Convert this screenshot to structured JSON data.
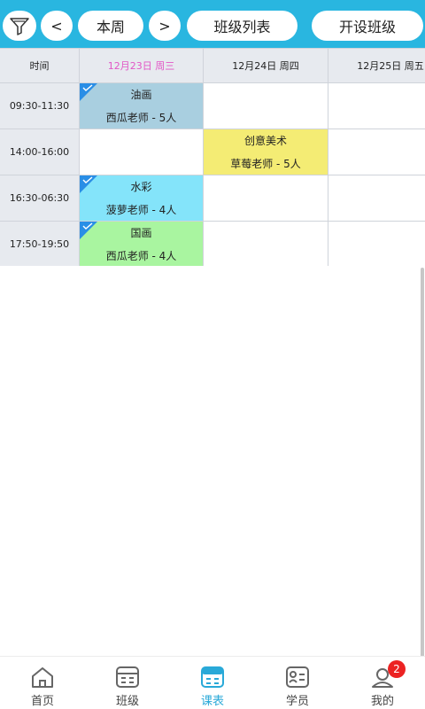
{
  "toolbar": {
    "filter_icon": "filter-funnel-icon",
    "prev_label": "<",
    "week_label": "本周",
    "next_label": ">",
    "class_list_label": "班级列表",
    "open_class_label": "开设班级"
  },
  "schedule": {
    "time_header": "时间",
    "days": [
      {
        "label": "12月23日 周三",
        "today": true
      },
      {
        "label": "12月24日 周四",
        "today": false
      },
      {
        "label": "12月25日 周五",
        "today": false
      }
    ],
    "slots": [
      "09:30-11:30",
      "14:00-16:00",
      "16:30-06:30",
      "17:50-19:50"
    ],
    "courses": [
      {
        "slot": 0,
        "day": 0,
        "name": "油画",
        "info": "西瓜老师 -  5人",
        "color": "#a9cfe0",
        "checked": true
      },
      {
        "slot": 1,
        "day": 1,
        "name": "创意美术",
        "info": "草莓老师 -  5人",
        "color": "#f4ec74",
        "checked": false
      },
      {
        "slot": 2,
        "day": 0,
        "name": "水彩",
        "info": "菠萝老师 -  4人",
        "color": "#84e4fa",
        "checked": true
      },
      {
        "slot": 3,
        "day": 0,
        "name": "国画",
        "info": "西瓜老师 -  4人",
        "color": "#a9f5a0",
        "checked": true
      }
    ],
    "colors": {
      "today_header": "#e257c6",
      "header_bg": "#e7eaef",
      "check_corner": "#2a8ee6"
    }
  },
  "bottom_nav": {
    "items": [
      {
        "label": "首页",
        "icon": "home-icon",
        "active": false
      },
      {
        "label": "班级",
        "icon": "class-icon",
        "active": false
      },
      {
        "label": "课表",
        "icon": "schedule-icon",
        "active": true
      },
      {
        "label": "学员",
        "icon": "student-icon",
        "active": false
      },
      {
        "label": "我的",
        "icon": "profile-icon",
        "active": false
      }
    ],
    "profile_badge": "2"
  },
  "colors": {
    "toolbar": "#29b6e0",
    "accent": "#29a9d8",
    "badge": "#ec2323"
  }
}
